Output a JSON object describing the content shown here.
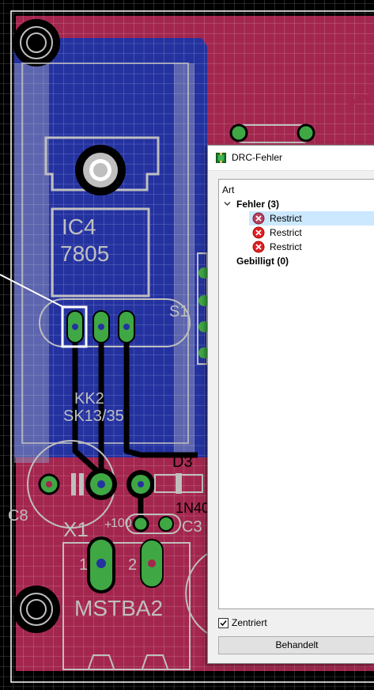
{
  "board": {
    "labels": {
      "ic_name": "IC4",
      "ic_value": "7805",
      "heatsink_name": "KK2",
      "heatsink_value": "SK13/35",
      "switch_name": "S1",
      "diode_name": "D3",
      "diode_value": "1N40",
      "cap_c8": "C8",
      "cap_c3": "C3",
      "cap_100": "100",
      "connector_name": "X1",
      "connector_value": "MSTBA2",
      "pin1": "1",
      "pin2": "2",
      "plus": "+"
    },
    "colors": {
      "background": "#000000",
      "grid": "#ffffff",
      "top_copper": "#a3264e",
      "bottom_copper": "#2432a0",
      "silkscreen": "#bfbfbf",
      "pads": "#3fa744",
      "drill": "#1e2ea8"
    }
  },
  "dialog": {
    "title": "DRC-Fehler",
    "column_header": "Art",
    "errors_group": "Fehler (3)",
    "errors": [
      {
        "label": "Restrict",
        "selected": true
      },
      {
        "label": "Restrict",
        "selected": false
      },
      {
        "label": "Restrict",
        "selected": false
      }
    ],
    "approved_group": "Gebilligt (0)",
    "center_checkbox": {
      "label": "Zentriert",
      "checked": true
    },
    "handled_button": "Behandelt",
    "icons": {
      "app": "pcb-board-icon",
      "expand": "chevron-down-icon",
      "error": "error-x-icon"
    }
  }
}
